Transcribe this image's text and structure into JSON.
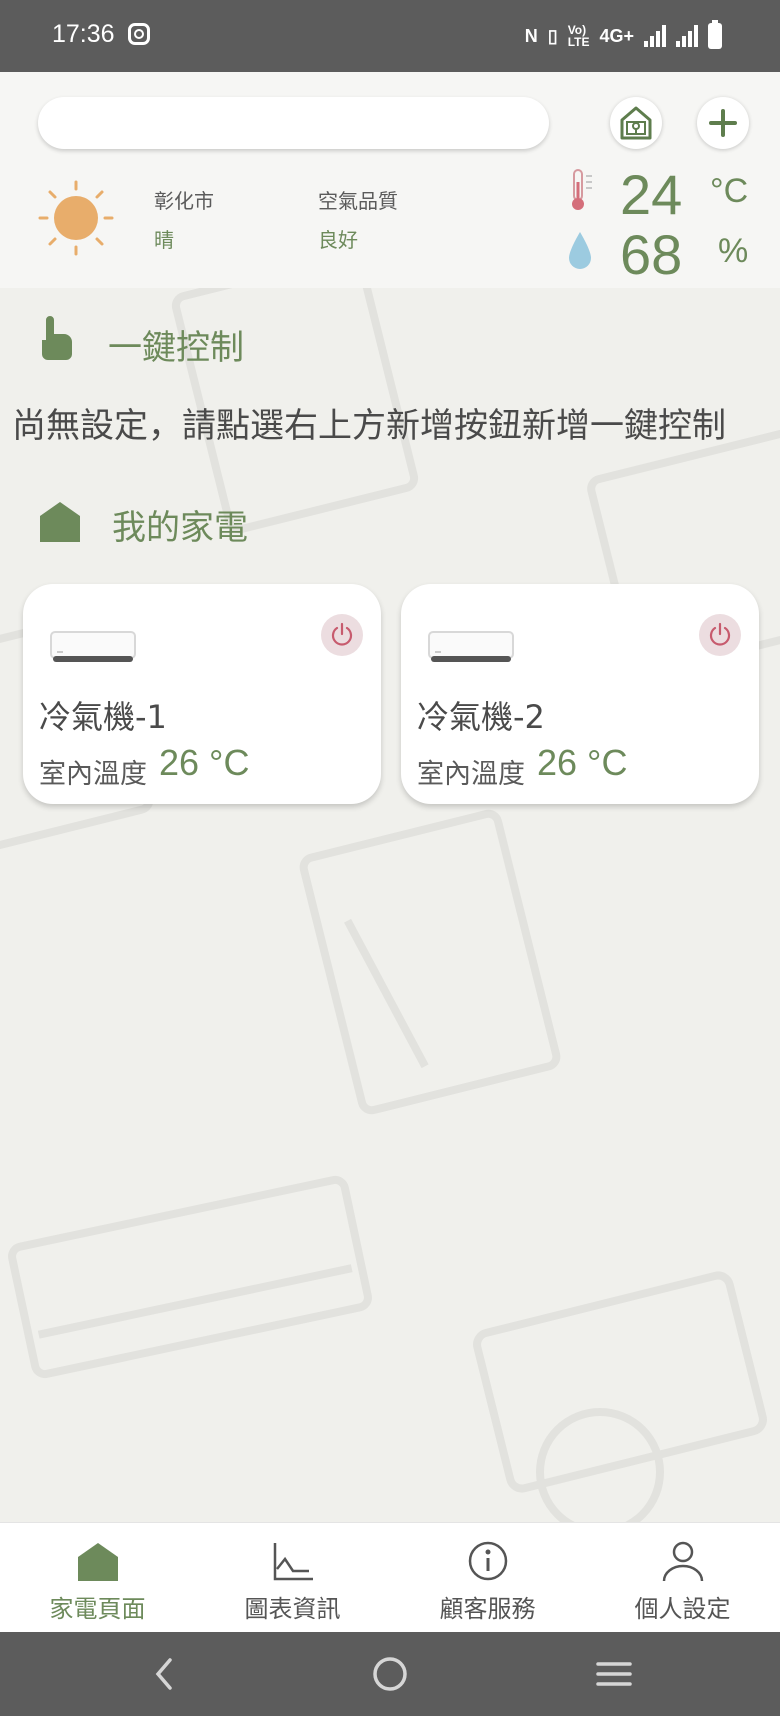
{
  "status_bar": {
    "time": "17:36",
    "network": "4G+",
    "volte": "VoLTE"
  },
  "header": {
    "search": {
      "value": "",
      "placeholder": ""
    },
    "home_button_icon": "home-lock-icon",
    "add_button_icon": "plus-icon"
  },
  "weather": {
    "icon": "sun-icon",
    "city": "彰化市",
    "condition": "晴",
    "air_quality_label": "空氣品質",
    "air_quality_value": "良好",
    "temperature": "24",
    "temperature_unit": "°C",
    "humidity": "68",
    "humidity_unit": "%"
  },
  "one_click": {
    "title": "一鍵控制",
    "empty_message": "尚無設定，請點選右上方新增按鈕新增一鍵控制"
  },
  "appliances": {
    "title": "我的家電",
    "items": [
      {
        "name": "冷氣機-1",
        "temp_label": "室內溫度",
        "temp_value": "26 °C",
        "icon": "air-conditioner-icon"
      },
      {
        "name": "冷氣機-2",
        "temp_label": "室內溫度",
        "temp_value": "26 °C",
        "icon": "air-conditioner-icon"
      }
    ]
  },
  "bottom_nav": [
    {
      "label": "家電頁面",
      "icon": "home-icon",
      "active": true
    },
    {
      "label": "圖表資訊",
      "icon": "chart-icon",
      "active": false
    },
    {
      "label": "顧客服務",
      "icon": "info-icon",
      "active": false
    },
    {
      "label": "個人設定",
      "icon": "person-icon",
      "active": false
    }
  ],
  "colors": {
    "accent": "#6d8a5b",
    "power": "#c75b6e",
    "status_bar": "#5c5c5c"
  }
}
